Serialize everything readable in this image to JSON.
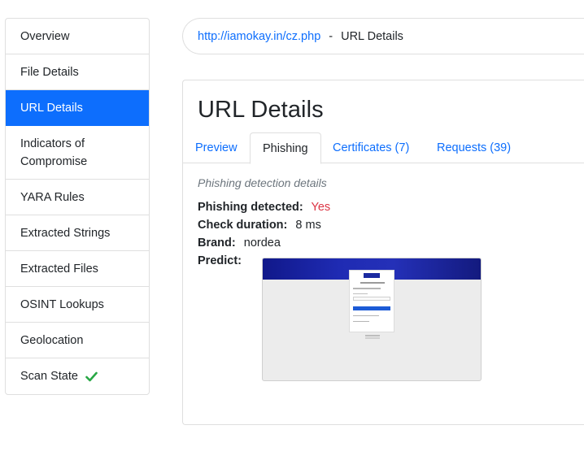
{
  "sidebar": {
    "items": [
      {
        "label": "Overview"
      },
      {
        "label": "File Details"
      },
      {
        "label": "URL Details"
      },
      {
        "label": "Indicators of Compromise"
      },
      {
        "label": "YARA Rules"
      },
      {
        "label": "Extracted Strings"
      },
      {
        "label": "Extracted Files"
      },
      {
        "label": "OSINT Lookups"
      },
      {
        "label": "Geolocation"
      },
      {
        "label": "Scan State"
      }
    ],
    "active_index": 2,
    "scan_state_icon": "check-icon",
    "accent_color": "#0d6efd",
    "check_color": "#28a745"
  },
  "breadcrumb": {
    "url": "http://iamokay.in/cz.php",
    "separator": "-",
    "current": "URL Details"
  },
  "main": {
    "title": "URL Details",
    "tabs": [
      {
        "label": "Preview"
      },
      {
        "label": "Phishing"
      },
      {
        "label": "Certificates (7)"
      },
      {
        "label": "Requests (39)"
      }
    ],
    "active_tab": 1,
    "section_description": "Phishing detection details",
    "details": {
      "phishing_detected_label": "Phishing detected:",
      "phishing_detected_value": "Yes",
      "check_duration_label": "Check duration:",
      "check_duration_value": "8 ms",
      "brand_label": "Brand:",
      "brand_value": "nordea",
      "predict_label": "Predict:"
    },
    "predict_image": "phishing-page-screenshot",
    "alert_color": "#dc3545"
  }
}
